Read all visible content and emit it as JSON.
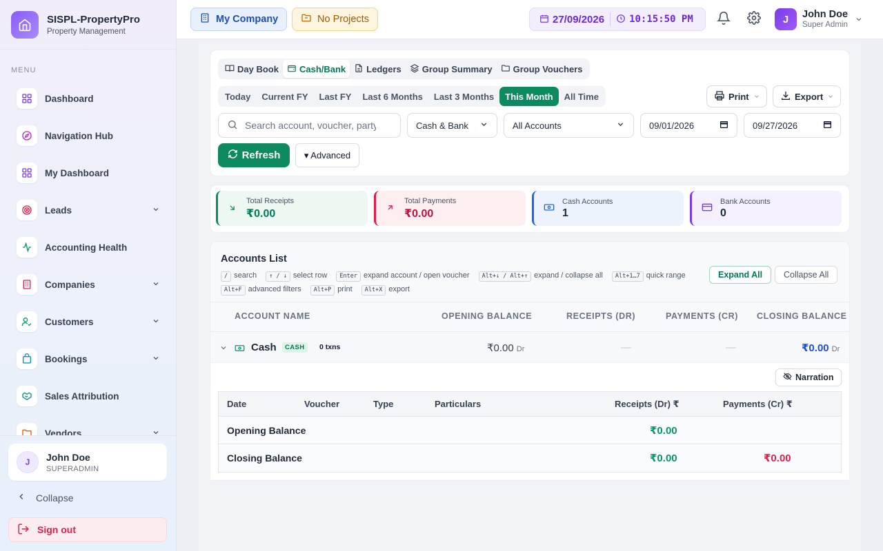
{
  "brand": {
    "title": "SISPL-PropertyPro",
    "subtitle": "Property Management"
  },
  "sidebar": {
    "menu_label": "MENU",
    "items": [
      {
        "label": "Dashboard",
        "icon": "grid-icon",
        "color": "#7c3aed",
        "expandable": false
      },
      {
        "label": "Navigation Hub",
        "icon": "compass-icon",
        "color": "#c026d3",
        "expandable": false
      },
      {
        "label": "My Dashboard",
        "icon": "grid-icon",
        "color": "#7c3aed",
        "expandable": false
      },
      {
        "label": "Leads",
        "icon": "target-icon",
        "color": "#e11d48",
        "expandable": true
      },
      {
        "label": "Accounting Health",
        "icon": "activity-icon",
        "color": "#059669",
        "expandable": false
      },
      {
        "label": "Companies",
        "icon": "building-icon",
        "color": "#e11d48",
        "expandable": true
      },
      {
        "label": "Customers",
        "icon": "user-check-icon",
        "color": "#059669",
        "expandable": true
      },
      {
        "label": "Bookings",
        "icon": "bag-icon",
        "color": "#0891b2",
        "expandable": true
      },
      {
        "label": "Sales Attribution",
        "icon": "handshake-icon",
        "color": "#0d9488",
        "expandable": false
      },
      {
        "label": "Vendors",
        "icon": "folder-icon",
        "color": "#ea580c",
        "expandable": true
      }
    ],
    "user": {
      "initial": "J",
      "name": "John Doe",
      "role": "SUPERADMIN"
    },
    "collapse_label": "Collapse",
    "signout_label": "Sign out"
  },
  "header": {
    "company_label": "My Company",
    "projects_label": "No Projects",
    "date": "27/09/2026",
    "time": "10:15:50 PM",
    "user": {
      "initial": "J",
      "name": "John Doe",
      "role": "Super Admin"
    }
  },
  "tabs": [
    {
      "label": "Day Book",
      "icon": "book-icon",
      "active": false
    },
    {
      "label": "Cash/Bank",
      "icon": "wallet-icon",
      "active": true
    },
    {
      "label": "Ledgers",
      "icon": "file-icon",
      "active": false
    },
    {
      "label": "Group Summary",
      "icon": "layers-icon",
      "active": false
    },
    {
      "label": "Group Vouchers",
      "icon": "folder-icon",
      "active": false
    }
  ],
  "ranges": [
    "Today",
    "Current FY",
    "Last FY",
    "Last 6 Months",
    "Last 3 Months",
    "This Month",
    "All Time"
  ],
  "active_range": "This Month",
  "toolbar": {
    "print_label": "Print",
    "export_label": "Export",
    "refresh_label": "Refresh",
    "advanced_label": "▾ Advanced"
  },
  "filters": {
    "search_placeholder": "Search account, voucher, party",
    "type_value": "Cash & Bank",
    "accounts_value": "All Accounts",
    "date_from": "09/01/2026",
    "date_to": "09/27/2026"
  },
  "stats": [
    {
      "label": "Total Receipts",
      "value": "₹0.00",
      "color": "#047857",
      "bg": "#ecf8f1",
      "accent": "#0d8a5f",
      "icon": "arrow-down-right-icon"
    },
    {
      "label": "Total Payments",
      "value": "₹0.00",
      "color": "#be123c",
      "bg": "#fdeef0",
      "accent": "#e11d48",
      "icon": "arrow-up-right-icon"
    },
    {
      "label": "Cash Accounts",
      "value": "1",
      "color": "#1f2937",
      "bg": "#edf3fd",
      "accent": "#2563eb",
      "icon": "banknote-icon"
    },
    {
      "label": "Bank Accounts",
      "value": "0",
      "color": "#1f2937",
      "bg": "#f5f0fd",
      "accent": "#7c3aed",
      "icon": "card-icon"
    }
  ],
  "accounts": {
    "title": "Accounts List",
    "hints": [
      {
        "keys": "/",
        "text": "search"
      },
      {
        "keys": "↑ / ↓",
        "text": "select row"
      },
      {
        "keys": "Enter",
        "text": "expand account / open voucher"
      },
      {
        "keys": "Alt+↓ / Alt+↑",
        "text": "expand / collapse all"
      },
      {
        "keys": "Alt+1…7",
        "text": "quick range"
      },
      {
        "keys": "Alt+F",
        "text": "advanced filters"
      },
      {
        "keys": "Alt+P",
        "text": "print"
      },
      {
        "keys": "Alt+X",
        "text": "export"
      }
    ],
    "expand_all": "Expand All",
    "collapse_all": "Collapse All",
    "columns": [
      "ACCOUNT NAME",
      "OPENING BALANCE",
      "RECEIPTS (DR)",
      "PAYMENTS (CR)",
      "CLOSING BALANCE"
    ],
    "row": {
      "name": "Cash",
      "badge": "CASH",
      "txns": "0 txns",
      "opening": "₹0.00",
      "opening_suffix": "Dr",
      "receipts": "—",
      "payments": "—",
      "closing": "₹0.00",
      "closing_suffix": "Dr"
    },
    "narration_label": "Narration",
    "voucher_columns": [
      "Date",
      "Voucher",
      "Type",
      "Particulars",
      "Receipts (Dr) ₹",
      "Payments (Cr) ₹"
    ],
    "opening_row": {
      "label": "Opening Balance",
      "receipts": "₹0.00"
    },
    "closing_row": {
      "label": "Closing Balance",
      "receipts": "₹0.00",
      "payments": "₹0.00"
    }
  }
}
